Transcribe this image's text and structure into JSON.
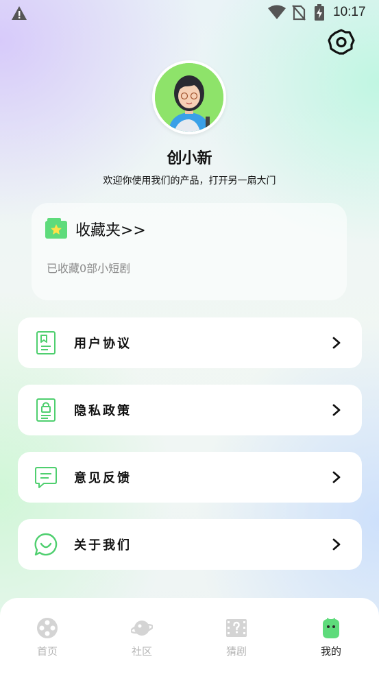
{
  "status_bar": {
    "time": "10:17"
  },
  "profile": {
    "name": "创小新",
    "slogan": "欢迎你使用我们的产品，打开另一扇大门"
  },
  "favorites": {
    "title": "收藏夹>>",
    "count_text": "已收藏0部小短剧"
  },
  "menu": [
    {
      "label": "用户协议",
      "icon": "document-icon"
    },
    {
      "label": "隐私政策",
      "icon": "lock-document-icon"
    },
    {
      "label": "意见反馈",
      "icon": "message-icon"
    },
    {
      "label": "关于我们",
      "icon": "chat-bubble-icon"
    }
  ],
  "bottom_nav": [
    {
      "label": "首页",
      "icon": "film-reel-icon",
      "active": false
    },
    {
      "label": "社区",
      "icon": "planet-icon",
      "active": false
    },
    {
      "label": "猜剧",
      "icon": "film-question-icon",
      "active": false
    },
    {
      "label": "我的",
      "icon": "smiley-icon",
      "active": true
    }
  ],
  "colors": {
    "accent_green": "#5edb7b",
    "icon_stroke_green": "#4fcf6f",
    "inactive_nav": "#d2d2d2",
    "text_primary": "#111111",
    "text_secondary": "#8a8a8a"
  }
}
